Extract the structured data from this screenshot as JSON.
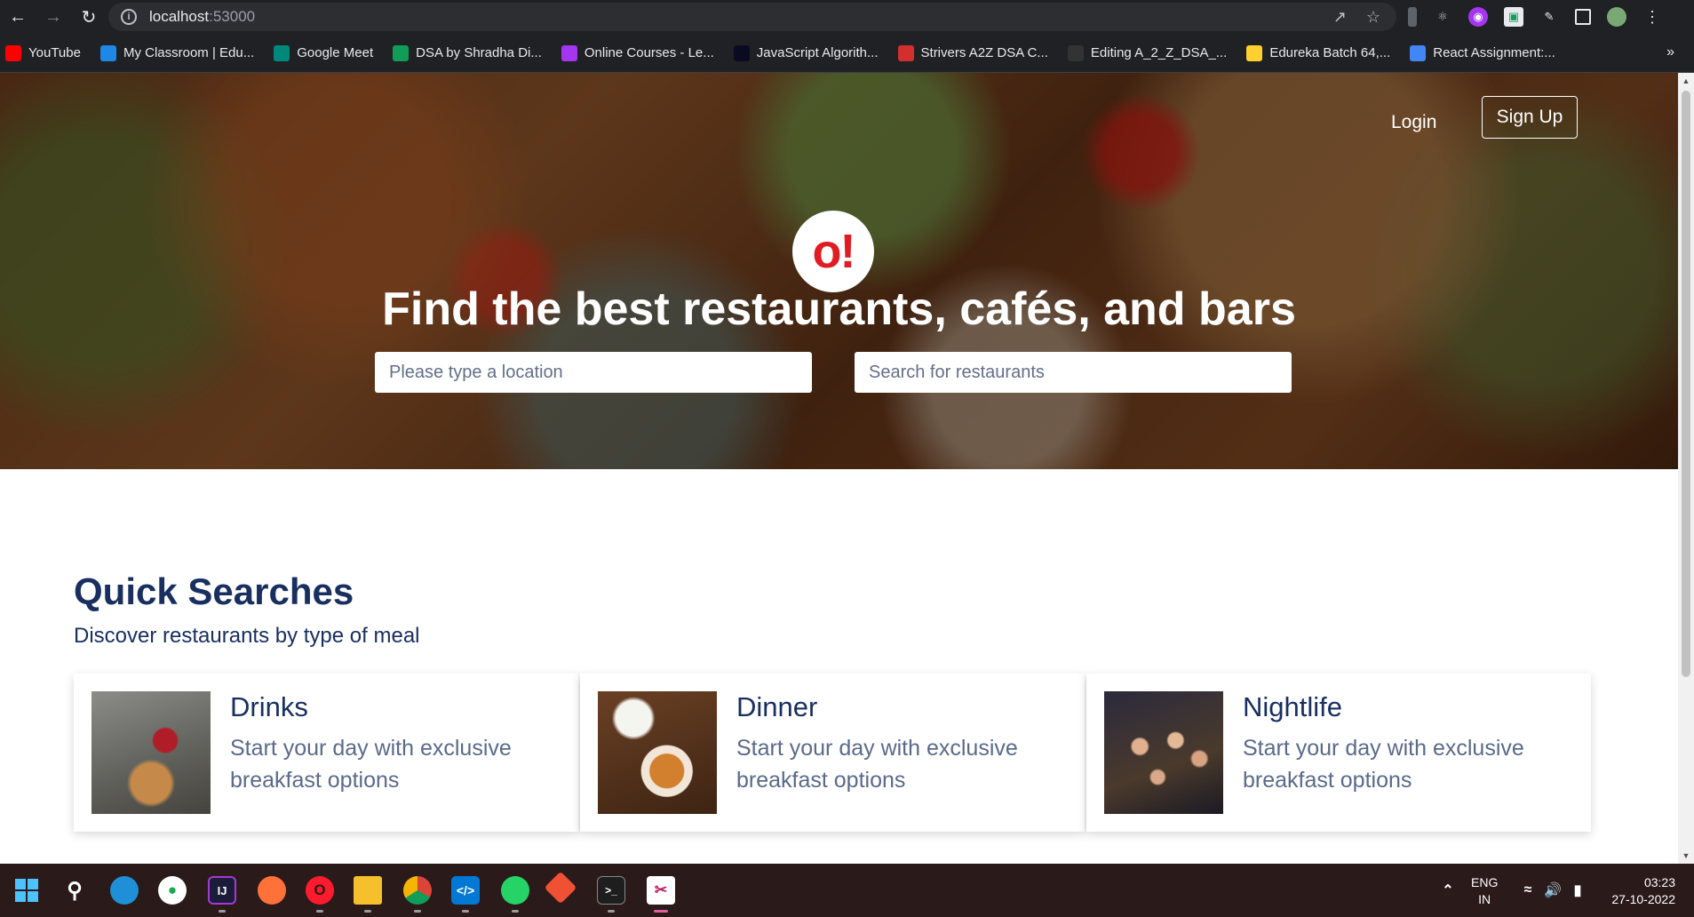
{
  "browser": {
    "url_host": "localhost",
    "url_port": ":53000",
    "bookmarks": [
      {
        "label": "YouTube",
        "icon": "youtube-icon",
        "color": "#ff0000"
      },
      {
        "label": "My Classroom | Edu...",
        "icon": "edureka-icon",
        "color": "#1e88e5"
      },
      {
        "label": "Google Meet",
        "icon": "google-meet-icon",
        "color": "#00897b"
      },
      {
        "label": "DSA by Shradha Di...",
        "icon": "google-sheets-icon",
        "color": "#0f9d58"
      },
      {
        "label": "Online Courses - Le...",
        "icon": "udemy-icon",
        "color": "#a435f0"
      },
      {
        "label": "JavaScript Algorith...",
        "icon": "freecodecamp-icon",
        "color": "#0a0a23"
      },
      {
        "label": "Strivers A2Z DSA C...",
        "icon": "tuf-icon",
        "color": "#d32f2f"
      },
      {
        "label": "Editing A_2_Z_DSA_...",
        "icon": "github-icon",
        "color": "#333333"
      },
      {
        "label": "Edureka Batch 64,...",
        "icon": "miro-icon",
        "color": "#ffd02f"
      },
      {
        "label": "React Assignment:...",
        "icon": "google-docs-icon",
        "color": "#4285f4"
      }
    ]
  },
  "hero": {
    "login_label": "Login",
    "signup_label": "Sign Up",
    "logo_text": "o!",
    "title": "Find the best restaurants, cafés, and bars",
    "location_placeholder": "Please type a location",
    "search_placeholder": "Search for restaurants",
    "brand_color": "#e11b23"
  },
  "quick_searches": {
    "title": "Quick Searches",
    "subtitle": "Discover restaurants by type of meal",
    "cards": [
      {
        "title": "Drinks",
        "description": "Start your day with exclusive breakfast options",
        "image": "drinks-image"
      },
      {
        "title": "Dinner",
        "description": "Start your day with exclusive breakfast options",
        "image": "dinner-image"
      },
      {
        "title": "Nightlife",
        "description": "Start your day with exclusive breakfast options",
        "image": "nightlife-image"
      }
    ]
  },
  "taskbar": {
    "lang_line1": "ENG",
    "lang_line2": "IN",
    "time": "03:23",
    "date": "27-10-2022"
  }
}
